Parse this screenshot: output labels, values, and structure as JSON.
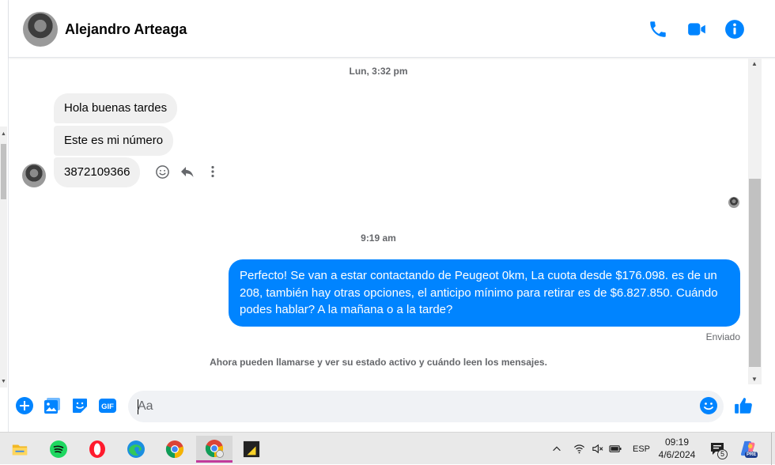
{
  "contact": {
    "name": "Alejandro Arteaga"
  },
  "header_icons": [
    "phone-icon",
    "video-camera-icon",
    "info-icon"
  ],
  "messages": {
    "timestamp_1": "Lun, 3:32 pm",
    "incoming": [
      {
        "text": "Hola buenas tardes"
      },
      {
        "text": "Este es mi número"
      },
      {
        "text": "3872109366"
      }
    ],
    "timestamp_2": "9:19 am",
    "outgoing": {
      "text": "Perfecto!  Se van a estar contactando de Peugeot 0km, La cuota desde $176.098. es de un 208, también hay otras opciones, el anticipo mínimo para retirar es de $6.827.850. Cuándo podes hablar? A la mañana o a la tarde?",
      "status": "Enviado"
    },
    "notice": "Ahora pueden llamarse y ver su estado activo y cuándo leen los mensajes."
  },
  "composer": {
    "placeholder": "Aa",
    "gif_label": "GIF"
  },
  "taskbar": {
    "language": "ESP",
    "time": "09:19",
    "date": "4/6/2024",
    "notification_count": "5",
    "pre_badge": "PRE"
  },
  "colors": {
    "accent": "#0084ff",
    "incoming_bubble": "#f0f0f0"
  }
}
